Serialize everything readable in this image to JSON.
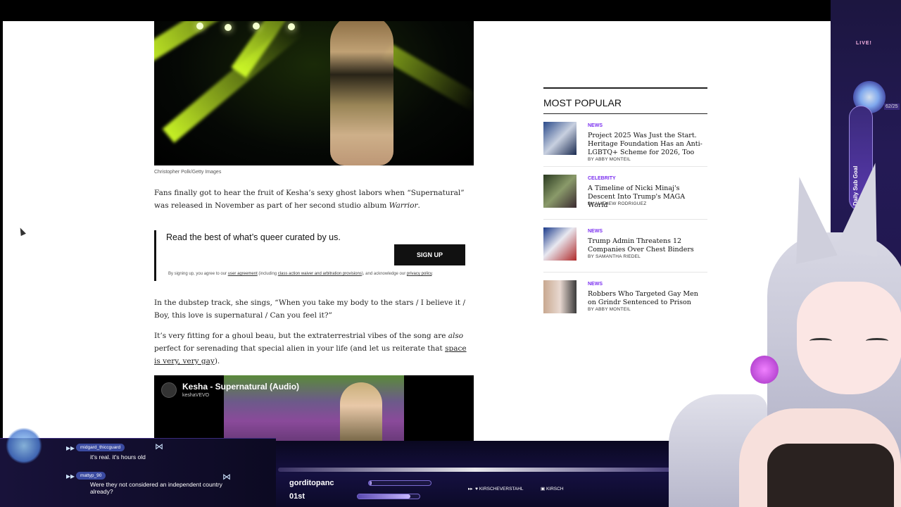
{
  "article": {
    "hero_caption": "Christopher Polk/Getty Images",
    "para1_text": "Fans finally got to hear the fruit of Kesha’s sexy ghost labors when “Supernatural” was released in November as part of her second studio album ",
    "para1_album": "Warrior",
    "para1_end": ".",
    "para2": "In the dubstep track, she sings, “When you take my body to the stars / I believe it / Boy, this love is supernatural / Can you feel it?”",
    "para3_start": "It’s very fitting for a ghoul beau, but the extraterrestrial vibes of the song are ",
    "para3_em": "also",
    "para3_mid": " perfect for serenading that special alien in your life (and let us reiterate that ",
    "para3_link": "space is very, very gay",
    "para3_end": ")."
  },
  "signup": {
    "title": "Read the best of what’s queer curated by us.",
    "button": "SIGN UP",
    "legal_1": "By signing up, you agree to our ",
    "legal_link1": "user agreement",
    "legal_2": " (including ",
    "legal_link2": "class action waiver and arbitration provisions",
    "legal_3": "), and acknowledge our ",
    "legal_link3": "privacy policy",
    "legal_4": "."
  },
  "video": {
    "title": "Kesha - Supernatural (Audio)",
    "channel": "keshaVEVO"
  },
  "most_popular": {
    "heading": "MOST POPULAR",
    "items": [
      {
        "category": "NEWS",
        "title": "Project 2025 Was Just the Start. Heritage Foundation Has an Anti-LGBTQ+ Scheme for 2026, Too",
        "byline": "BY ABBY MONTEIL"
      },
      {
        "category": "CELEBRITY",
        "title": "A Timeline of Nicki Minaj's Descent Into Trump's MAGA World",
        "byline": "BY MATHEW RODRIGUEZ"
      },
      {
        "category": "NEWS",
        "title": "Trump Admin Threatens 12 Companies Over Chest Binders",
        "byline": "BY SAMANTHA RIEDEL"
      },
      {
        "category": "NEWS",
        "title": "Robbers Who Targeted Gay Men on Grindr Sentenced to Prison",
        "byline": "BY ABBY MONTEIL"
      }
    ]
  },
  "overlay": {
    "live": "LIVE!",
    "goal_label": "Daily Sub Goal",
    "goal_count": "62/25",
    "chat": [
      {
        "user": "midgard_thiccguard",
        "message": "it's real. it's hours old"
      },
      {
        "user": "mattyp_90",
        "message": "Were they not considered an independent country already?"
      }
    ],
    "stat1_name": "gorditopanc",
    "stat1_fill": 0.05,
    "stat2_name": "01st",
    "stat2_fill": 0.85,
    "social1": "KIRSCHEVERSTAHL",
    "social2": "KIRSCH"
  },
  "colors": {
    "category": "#7b2ff0",
    "accent_overlay": "#3a2a7a"
  }
}
